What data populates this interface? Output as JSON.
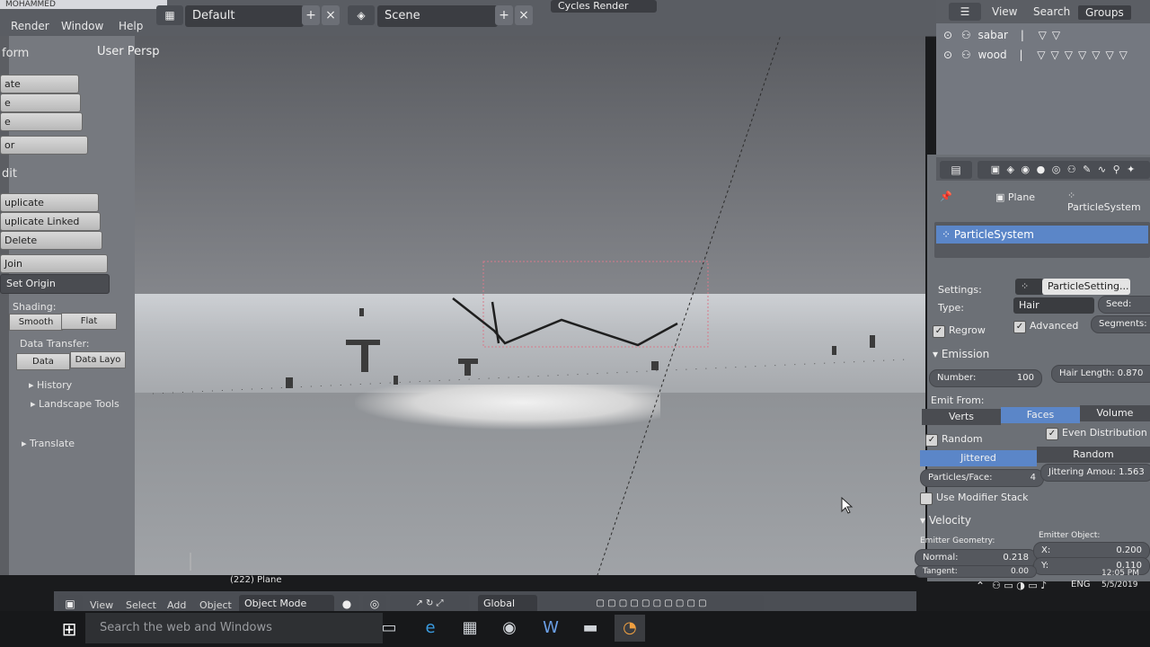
{
  "window_title_fragment": "MOHAMMED",
  "menu": {
    "render": "Render",
    "window": "Window",
    "help": "Help"
  },
  "screen_layout": {
    "value": "Default"
  },
  "scene": {
    "value": "Scene"
  },
  "render_engine": {
    "value": "Cycles Render"
  },
  "shelf": {
    "transform_header": "form",
    "transform_buttons": [
      "ate",
      "e",
      "e",
      "or"
    ],
    "edit_header": "dit",
    "edit_buttons": [
      "uplicate",
      "uplicate Linked",
      "Delete",
      "Join"
    ],
    "set_origin": "Set Origin",
    "shading_label": "Shading:",
    "smooth": "Smooth",
    "flat": "Flat",
    "data_transfer_label": "Data Transfer:",
    "data": "Data",
    "data_layout": "Data Layo",
    "history": "History",
    "landscape_tools": "Landscape Tools",
    "translate": "Translate"
  },
  "viewport": {
    "label": "User Persp",
    "status": "(222) Plane"
  },
  "bottom_header": {
    "view": "View",
    "select": "Select",
    "add": "Add",
    "object": "Object",
    "mode": "Object Mode",
    "orientation": "Global"
  },
  "outliner": {
    "tabs": {
      "view": "View",
      "search": "Search",
      "groups": "Groups"
    },
    "rows": [
      {
        "name": "sabar"
      },
      {
        "name": "wood"
      }
    ]
  },
  "properties": {
    "breadcrumb": {
      "object": "Plane",
      "system": "ParticleSystem"
    },
    "particle_system_name": "ParticleSystem",
    "settings_label": "Settings:",
    "settings_value": "ParticleSetting...",
    "type_label": "Type:",
    "type_value": "Hair",
    "seed_label": "Seed:",
    "regrow": "Regrow",
    "advanced": "Advanced",
    "segments_label": "Segments:",
    "emission_header": "Emission",
    "number_label": "Number:",
    "number_value": "100",
    "hair_length_label": "Hair Length:",
    "hair_length_value": "0.870",
    "emit_from_label": "Emit From:",
    "emit_from_options": [
      "Verts",
      "Faces",
      "Volume"
    ],
    "emit_from_selected": "Faces",
    "random": "Random",
    "even_distribution": "Even Distribution",
    "distribution_options": [
      "Jittered",
      "Random"
    ],
    "particles_face_label": "Particles/Face:",
    "particles_face_value": "4",
    "jittering_label": "Jittering Amou:",
    "jittering_value": "1.563",
    "use_modifier_stack": "Use Modifier Stack",
    "velocity_header": "Velocity",
    "emitter_geometry": "Emitter Geometry:",
    "emitter_object": "Emitter Object:",
    "normal_label": "Normal:",
    "normal_value": "0.218",
    "tangent_label": "Tangent:",
    "tangent_value": "0.00",
    "x_label": "X:",
    "x_value": "0.200",
    "y_label": "Y:",
    "y_value": "0.110"
  },
  "taskbar": {
    "search_placeholder": "Search the web and Windows",
    "lang": "ENG",
    "time": "12:05 PM",
    "date": "5/5/2019"
  },
  "colors": {
    "selected_blue": "#5b86c8",
    "viewport_top": "#5a5c61",
    "panel_gray": "#6c7076"
  }
}
